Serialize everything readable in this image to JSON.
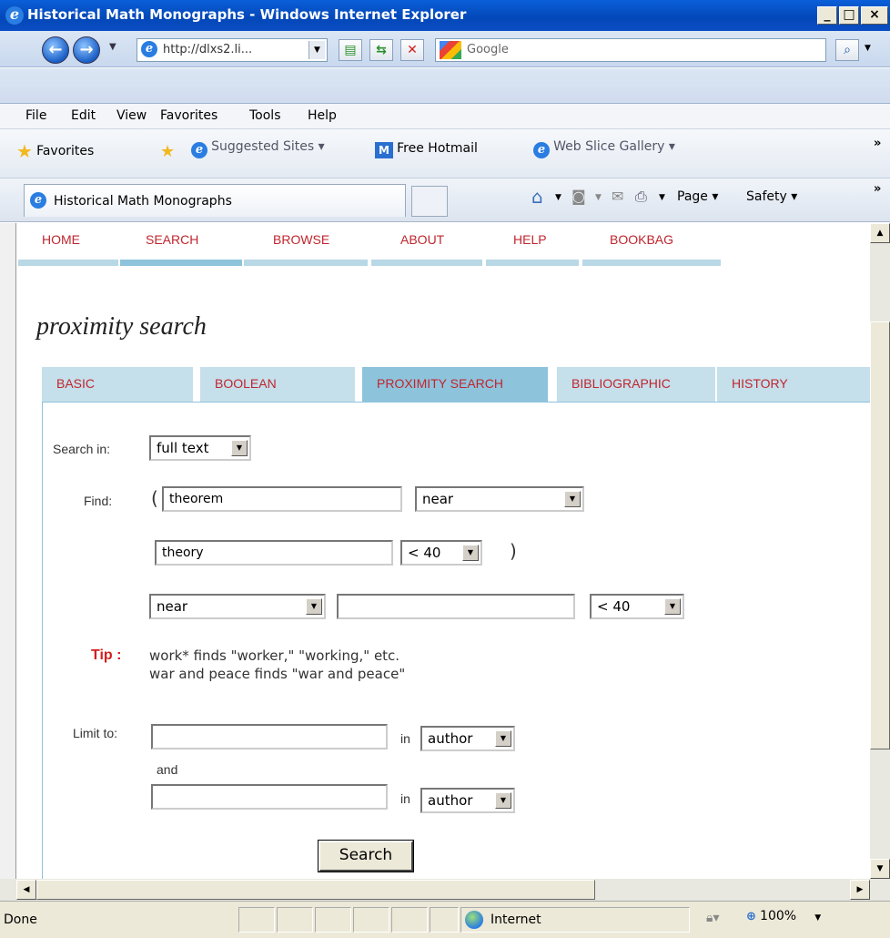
{
  "window": {
    "title": "Historical Math Monographs - Windows Internet Explorer",
    "minimize": "_",
    "maximize": "□",
    "close": "×"
  },
  "address": {
    "url": "http://dlxs2.li...",
    "search_placeholder": "Google"
  },
  "menu": [
    "File",
    "Edit",
    "View",
    "Favorites",
    "Tools",
    "Help"
  ],
  "favorites": {
    "favorites_label": "Favorites",
    "suggested_sites": "Suggested Sites ▾",
    "free_hotmail": "Free Hotmail",
    "web_slice_gallery": "Web Slice Gallery ▾"
  },
  "tab": {
    "title": "Historical Math Monographs"
  },
  "commands": {
    "page": "Page ▾",
    "safety": "Safety ▾"
  },
  "site_nav": [
    "HOME",
    "SEARCH",
    "BROWSE",
    "ABOUT",
    "HELP",
    "BOOKBAG"
  ],
  "page_title": "proximity search",
  "search_tabs": [
    "BASIC",
    "BOOLEAN",
    "PROXIMITY SEARCH",
    "BIBLIOGRAPHIC",
    "HISTORY"
  ],
  "form": {
    "search_in_label": "Search in:",
    "search_in_value": "full text",
    "find_label": "Find:",
    "open_paren": "(",
    "close_paren": ")",
    "term1": "theorem",
    "op1": "near",
    "term2": "theory",
    "dist1": "< 40",
    "op2": "near",
    "term3": "",
    "dist2": "< 40",
    "tip_label": "Tip :",
    "tip_line1": "work* finds \"worker,\" \"working,\" etc.",
    "tip_line2": "war and peace finds \"war and peace\"",
    "limit_label": "Limit to:",
    "in1": "in",
    "limit_field1": "author",
    "and_label": "and",
    "in2": "in",
    "limit_field2": "author",
    "search_button": "Search"
  },
  "status": {
    "text": "Done",
    "zone": "Internet",
    "zoom": "100%"
  },
  "colors": {
    "nav_red": "#c0262e",
    "tab_blue": "#c5dfeb",
    "tab_active": "#8ec3dc",
    "title_bar": "#0a5fd8"
  }
}
